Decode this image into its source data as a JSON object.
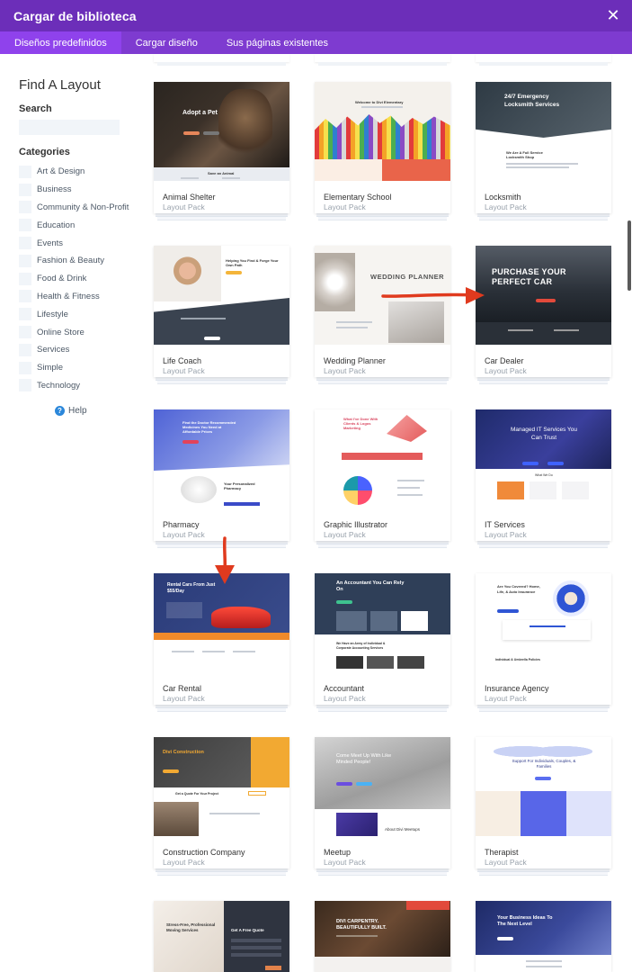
{
  "header": {
    "title": "Cargar de biblioteca",
    "close_icon": "close-icon"
  },
  "tabs": [
    {
      "label": "Diseños predefinidos",
      "active": true
    },
    {
      "label": "Cargar diseño",
      "active": false
    },
    {
      "label": "Sus páginas existentes",
      "active": false
    }
  ],
  "sidebar": {
    "title": "Find A Layout",
    "search_label": "Search",
    "search_value": "",
    "categories_label": "Categories",
    "categories": [
      "Art & Design",
      "Business",
      "Community & Non-Profit",
      "Education",
      "Events",
      "Fashion & Beauty",
      "Food & Drink",
      "Health & Fitness",
      "Lifestyle",
      "Online Store",
      "Services",
      "Simple",
      "Technology"
    ],
    "help_label": "Help"
  },
  "layouts": [
    {
      "name": "Animal Shelter",
      "sub": "Layout Pack",
      "hero": "Adopt a Pet",
      "subhero": "Save an Animal"
    },
    {
      "name": "Elementary School",
      "sub": "Layout Pack",
      "hero": "Welcome to Divi Elementary"
    },
    {
      "name": "Locksmith",
      "sub": "Layout Pack",
      "hero": "24/7 Emergency Locksmith Services",
      "subhero": "We Are A Full Service Locksmith Shop"
    },
    {
      "name": "Life Coach",
      "sub": "Layout Pack",
      "hero": "Helping You Find & Forge Your Own Path"
    },
    {
      "name": "Wedding Planner",
      "sub": "Layout Pack",
      "hero": "WEDDING PLANNER"
    },
    {
      "name": "Car Dealer",
      "sub": "Layout Pack",
      "hero": "PURCHASE YOUR PERFECT CAR"
    },
    {
      "name": "Pharmacy",
      "sub": "Layout Pack",
      "hero": "Find the Doctor Recommended Medicines You Need at Affordable Prices",
      "subhero": "Your Personalized Pharmacy"
    },
    {
      "name": "Graphic Illustrator",
      "sub": "Layout Pack",
      "hero": "What I've Done With Clients & Logos Marketing"
    },
    {
      "name": "IT Services",
      "sub": "Layout Pack",
      "hero": "Managed IT Services You Can Trust",
      "subhero": "What We Do"
    },
    {
      "name": "Car Rental",
      "sub": "Layout Pack",
      "hero": "Rental Cars From Just $55/Day"
    },
    {
      "name": "Accountant",
      "sub": "Layout Pack",
      "hero": "An Accountant You Can Rely On",
      "subhero": "We Have an Army of Individual & Corporate Accounting Services"
    },
    {
      "name": "Insurance Agency",
      "sub": "Layout Pack",
      "hero": "Are You Covered? Home, Life, & Auto Insurance",
      "subhero": "Individual & Umbrella Policies"
    },
    {
      "name": "Construction Company",
      "sub": "Layout Pack",
      "hero": "Divi Construction",
      "subhero": "Get a Quote For Your Project"
    },
    {
      "name": "Meetup",
      "sub": "Layout Pack",
      "hero": "Come Meet Up With Like Minded People!",
      "subhero": "About Divi Meetups"
    },
    {
      "name": "Therapist",
      "sub": "Layout Pack",
      "hero": "Support For Individuals, Couples, & Families"
    },
    {
      "name": "",
      "sub": "",
      "hero": "Stress-Free, Professional Moving Services",
      "subhero": "Get A Free Quote"
    },
    {
      "name": "",
      "sub": "",
      "hero": "DIVI CARPENTRY. BEAUTIFULLY BUILT."
    },
    {
      "name": "",
      "sub": "",
      "hero": "Your Business Ideas To The Next Level"
    }
  ],
  "colors": {
    "header": "#6c2eb9",
    "tabs": "#7e3bd0",
    "tab_active": "#8f42ec",
    "help": "#2b87da",
    "arrow": "#e03a1e"
  }
}
